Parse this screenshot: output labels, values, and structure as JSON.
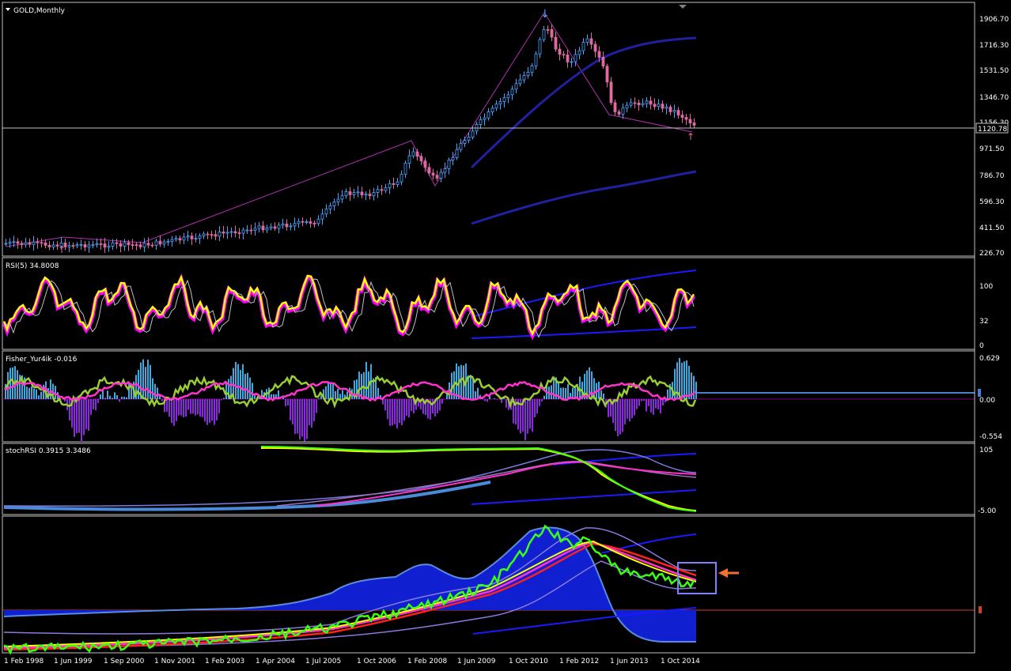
{
  "window": {
    "title": "GOLD,Monthly"
  },
  "panes": {
    "price": {
      "label": "GOLD,Monthly",
      "ticks": [
        "1906.70",
        "1716.30",
        "1531.50",
        "1346.70",
        "1156.30",
        "971.50",
        "786.70",
        "596.30",
        "411.50",
        "226.70"
      ],
      "current_price": "1120.78"
    },
    "rsi": {
      "label": "RSI(5) 34.8008",
      "ticks": [
        "100",
        "32",
        "0"
      ]
    },
    "fisher": {
      "label": "Fisher_Yur4ik -0.016",
      "ticks": [
        "0.629",
        "0.00",
        "-0.554"
      ]
    },
    "stochrsi": {
      "label": "stochRSI 0.3915 3.3486",
      "ticks": [
        "105",
        "-5.00"
      ]
    },
    "custom": {
      "label": "",
      "ticks": []
    }
  },
  "time_axis": [
    "1 Feb 1998",
    "1 Jun 1999",
    "1 Sep 2000",
    "1 Nov 2001",
    "1 Feb 2003",
    "1 Apr 2004",
    "1 Jul 2005",
    "1 Oct 2006",
    "1 Feb 2008",
    "1 Jun 2009",
    "1 Oct 2010",
    "1 Feb 2012",
    "1 Jun 2013",
    "1 Oct 2014"
  ],
  "colors": {
    "background": "#000000",
    "grid": "#c0c0c0",
    "bull": "#4aa3ff",
    "bear": "#e06aa0",
    "rsi": "#ffff00",
    "rsi_shadow": "#ff00ff",
    "fisher_pos": "#3fa9e0",
    "fisher_neg": "#8a2be2",
    "stoch_main": "#ffff00",
    "stoch_sig": "#39ff14",
    "band": "#1a1aff",
    "annotation_box": "#8080ff",
    "arrow": "#f07030"
  }
}
